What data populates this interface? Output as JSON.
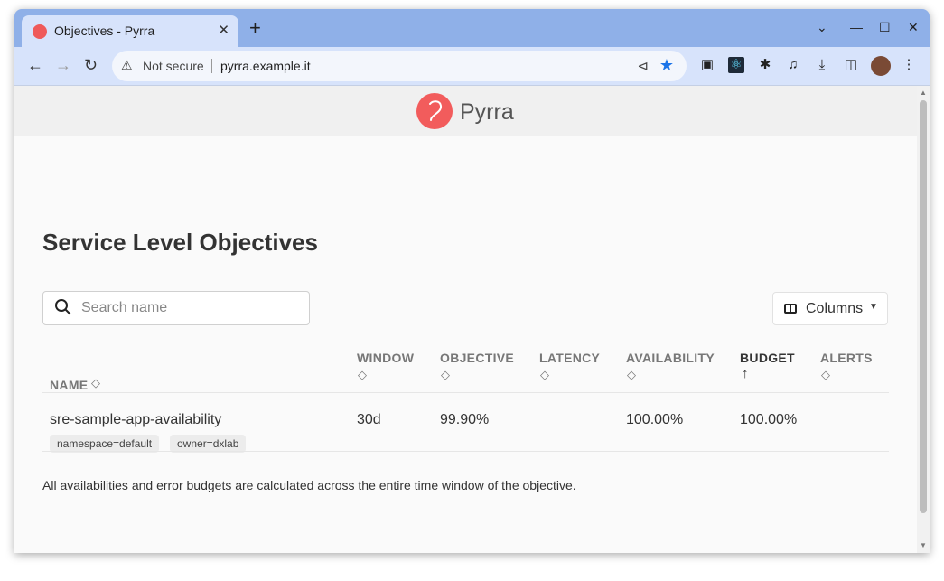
{
  "browser": {
    "tab_title": "Objectives - Pyrra",
    "tab_close": "✕",
    "new_tab": "+",
    "window_controls": {
      "dropdown": "⌄",
      "minimize": "—",
      "maximize": "☐",
      "close": "✕"
    },
    "omnibox": {
      "security_label": "Not secure",
      "url": "pyrra.example.it"
    },
    "icons": [
      "back-icon",
      "forward-icon",
      "reload-icon",
      "warning-icon",
      "share-icon",
      "star-icon",
      "extension-icons",
      "download-icon",
      "sidepanel-icon",
      "avatar",
      "menu-icon"
    ]
  },
  "app": {
    "logo_text": "Pyrra",
    "page_title": "Service Level Objectives",
    "search": {
      "placeholder": "Search name"
    },
    "columns_button": "Columns",
    "table": {
      "headers": {
        "name": "NAME",
        "window": "WINDOW",
        "objective": "OBJECTIVE",
        "latency": "LATENCY",
        "availability": "AVAILABILITY",
        "budget": "BUDGET",
        "alerts": "ALERTS"
      },
      "sorted_by": "budget",
      "rows": [
        {
          "name": "sre-sample-app-availability",
          "labels": [
            "namespace=default",
            "owner=dxlab"
          ],
          "window": "30d",
          "objective": "99.90%",
          "latency": "",
          "availability": "100.00%",
          "budget": "100.00%",
          "alerts": ""
        }
      ]
    },
    "footnote": "All availabilities and error budgets are calculated across the entire time window of the objective."
  },
  "colors": {
    "brand": "#f25c5c",
    "chrome_frame": "#8fb0e8",
    "chrome_toolbar": "#d7e3fb",
    "star": "#1a73e8"
  }
}
